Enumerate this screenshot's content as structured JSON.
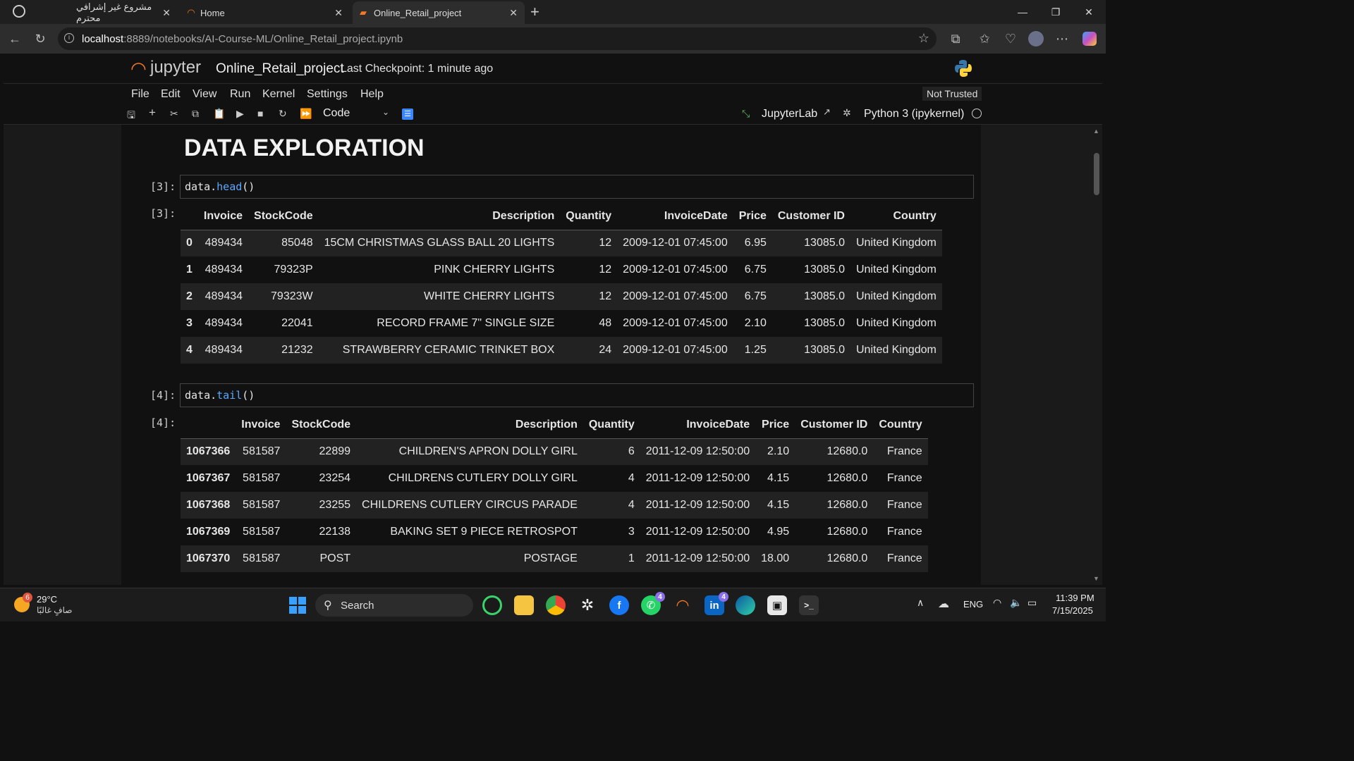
{
  "browser": {
    "tabs": [
      {
        "title": "مشروع غير إشرافي محترم",
        "active": false
      },
      {
        "title": "Home",
        "active": false
      },
      {
        "title": "Online_Retail_project",
        "active": true
      }
    ],
    "new_tab_icon": "plus-icon",
    "url_host": "localhost",
    "url_rest": ":8889/notebooks/AI-Course-ML/Online_Retail_project.ipynb"
  },
  "jupyter": {
    "logo_text": "jupyter",
    "notebook_title": "Online_Retail_project",
    "checkpoint": "Last Checkpoint: 1 minute ago",
    "menu": [
      "File",
      "Edit",
      "View",
      "Run",
      "Kernel",
      "Settings",
      "Help"
    ],
    "not_trusted": "Not Trusted",
    "cell_type": "Code",
    "jupyterlab_label": "JupyterLab",
    "kernel": "Python 3 (ipykernel)"
  },
  "notebook": {
    "heading": "DATA EXPLORATION",
    "cells": [
      {
        "prompt_in": "[3]:",
        "code_obj": "data.",
        "code_fn": "head",
        "code_end": "()",
        "prompt_out": "[3]:",
        "columns": [
          "",
          "Invoice",
          "StockCode",
          "Description",
          "Quantity",
          "InvoiceDate",
          "Price",
          "Customer ID",
          "Country"
        ],
        "rows": [
          [
            "0",
            "489434",
            "85048",
            "15CM CHRISTMAS GLASS BALL 20 LIGHTS",
            "12",
            "2009-12-01 07:45:00",
            "6.95",
            "13085.0",
            "United Kingdom"
          ],
          [
            "1",
            "489434",
            "79323P",
            "PINK CHERRY LIGHTS",
            "12",
            "2009-12-01 07:45:00",
            "6.75",
            "13085.0",
            "United Kingdom"
          ],
          [
            "2",
            "489434",
            "79323W",
            "WHITE CHERRY LIGHTS",
            "12",
            "2009-12-01 07:45:00",
            "6.75",
            "13085.0",
            "United Kingdom"
          ],
          [
            "3",
            "489434",
            "22041",
            "RECORD FRAME 7\" SINGLE SIZE",
            "48",
            "2009-12-01 07:45:00",
            "2.10",
            "13085.0",
            "United Kingdom"
          ],
          [
            "4",
            "489434",
            "21232",
            "STRAWBERRY CERAMIC TRINKET BOX",
            "24",
            "2009-12-01 07:45:00",
            "1.25",
            "13085.0",
            "United Kingdom"
          ]
        ]
      },
      {
        "prompt_in": "[4]:",
        "code_obj": "data.",
        "code_fn": "tail",
        "code_end": "()",
        "prompt_out": "[4]:",
        "columns": [
          "",
          "Invoice",
          "StockCode",
          "Description",
          "Quantity",
          "InvoiceDate",
          "Price",
          "Customer ID",
          "Country"
        ],
        "rows": [
          [
            "1067366",
            "581587",
            "22899",
            "CHILDREN'S APRON DOLLY GIRL",
            "6",
            "2011-12-09 12:50:00",
            "2.10",
            "12680.0",
            "France"
          ],
          [
            "1067367",
            "581587",
            "23254",
            "CHILDRENS CUTLERY DOLLY GIRL",
            "4",
            "2011-12-09 12:50:00",
            "4.15",
            "12680.0",
            "France"
          ],
          [
            "1067368",
            "581587",
            "23255",
            "CHILDRENS CUTLERY CIRCUS PARADE",
            "4",
            "2011-12-09 12:50:00",
            "4.15",
            "12680.0",
            "France"
          ],
          [
            "1067369",
            "581587",
            "22138",
            "BAKING SET 9 PIECE RETROSPOT",
            "3",
            "2011-12-09 12:50:00",
            "4.95",
            "12680.0",
            "France"
          ],
          [
            "1067370",
            "581587",
            "POST",
            "POSTAGE",
            "1",
            "2011-12-09 12:50:00",
            "18.00",
            "12680.0",
            "France"
          ]
        ]
      }
    ]
  },
  "taskbar": {
    "weather_temp": "29°C",
    "weather_desc": "صافٍ غالبًا",
    "weather_badge": "6",
    "search_placeholder": "Search",
    "whatsapp_badge": "4",
    "linkedin_badge": "4",
    "lang": "ENG",
    "time": "11:39 PM",
    "date": "7/15/2025"
  },
  "colors": {
    "accent_orange": "#f37726",
    "link_blue": "#5aa8ff",
    "active_tab": "#2d2d2d"
  }
}
